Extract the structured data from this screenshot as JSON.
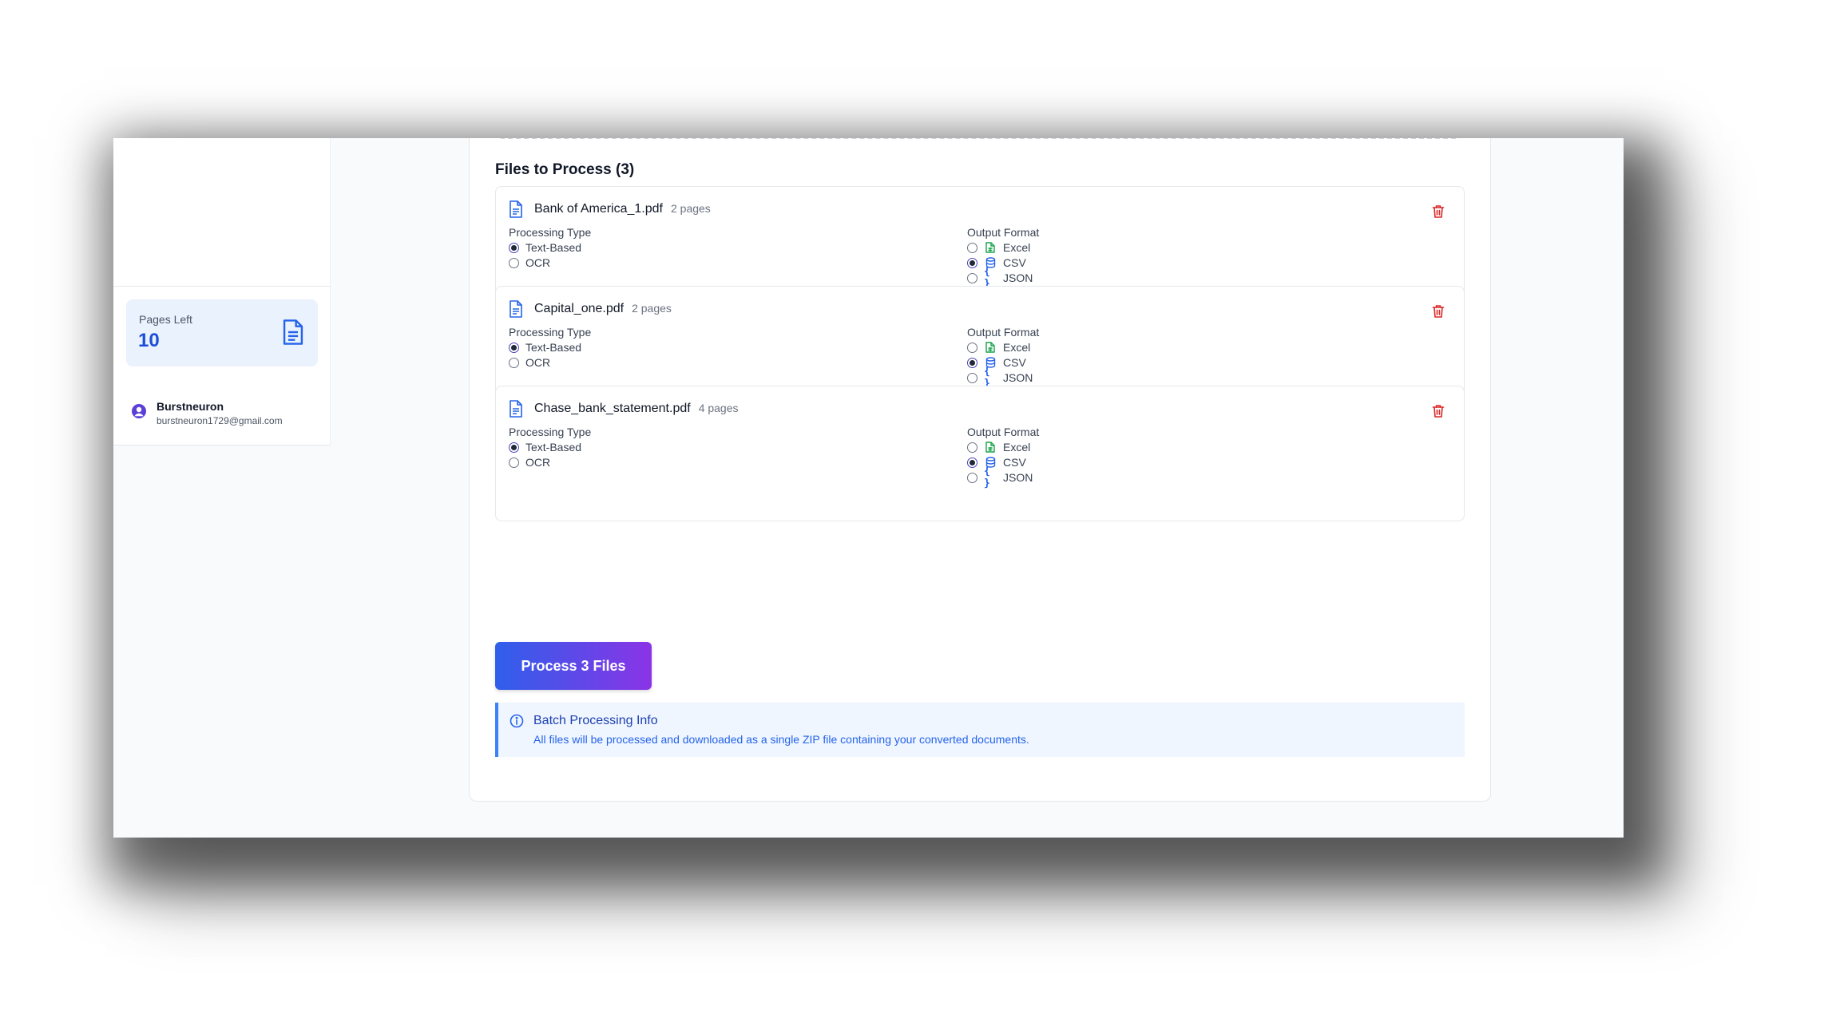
{
  "sidebar": {
    "pages_left_label": "Pages Left",
    "pages_left_value": "10",
    "user": {
      "name": "Burstneuron",
      "email": "burstneuron1729@gmail.com"
    }
  },
  "main": {
    "section_title": "Files to Process (3)",
    "processing_type_label": "Processing Type",
    "output_format_label": "Output Format",
    "processing_options": [
      "Text-Based",
      "OCR"
    ],
    "format_options": [
      "Excel",
      "CSV",
      "JSON"
    ],
    "files": [
      {
        "name": "Bank of America_1.pdf",
        "pages": "2 pages",
        "processing": "Text-Based",
        "format": "CSV"
      },
      {
        "name": "Capital_one.pdf",
        "pages": "2 pages",
        "processing": "Text-Based",
        "format": "CSV"
      },
      {
        "name": "Chase_bank_statement.pdf",
        "pages": "4 pages",
        "processing": "Text-Based",
        "format": "CSV"
      }
    ],
    "process_button_label": "Process 3 Files",
    "info": {
      "title": "Batch Processing Info",
      "text": "All files will be processed and downloaded as a single ZIP file containing your converted documents."
    }
  },
  "colors": {
    "accent_blue": "#2563eb",
    "gradient_start": "#2f5fea",
    "gradient_end": "#8a34e6",
    "trash_red": "#dc2626",
    "excel_green": "#16a34a",
    "pages_card_bg": "#eaf2fe"
  },
  "icons": {
    "file": "file-text-icon",
    "trash": "trash-icon",
    "excel": "file-spreadsheet-icon",
    "csv": "database-icon",
    "json": "braces-icon",
    "info": "info-icon",
    "avatar": "user-circle-icon"
  }
}
